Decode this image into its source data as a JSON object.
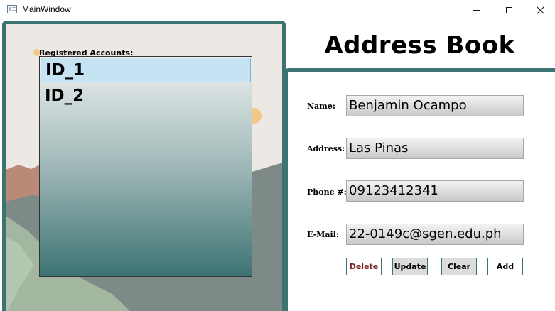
{
  "window": {
    "title": "MainWindow",
    "controls": [
      "minimize",
      "maximize",
      "close"
    ]
  },
  "accounts": {
    "label": "Registered Accounts:",
    "items": [
      {
        "label": "ID_1",
        "selected": true
      },
      {
        "label": "ID_2",
        "selected": false
      }
    ]
  },
  "header": {
    "title": "Address Book"
  },
  "form": {
    "name": {
      "label": "Name:",
      "value": "Benjamin Ocampo"
    },
    "address": {
      "label": "Address:",
      "value": "Las Pinas"
    },
    "phone": {
      "label": "Phone #:",
      "value": "09123412341"
    },
    "email": {
      "label": "E-Mail:",
      "value": "22-0149c@sgen.edu.ph"
    }
  },
  "buttons": {
    "delete": "Delete",
    "update": "Update",
    "clear": "Clear",
    "add": "Add"
  },
  "colors": {
    "accent": "#3d7373",
    "selection": "#c6e3f3",
    "delete_text": "#7a1f1f"
  }
}
